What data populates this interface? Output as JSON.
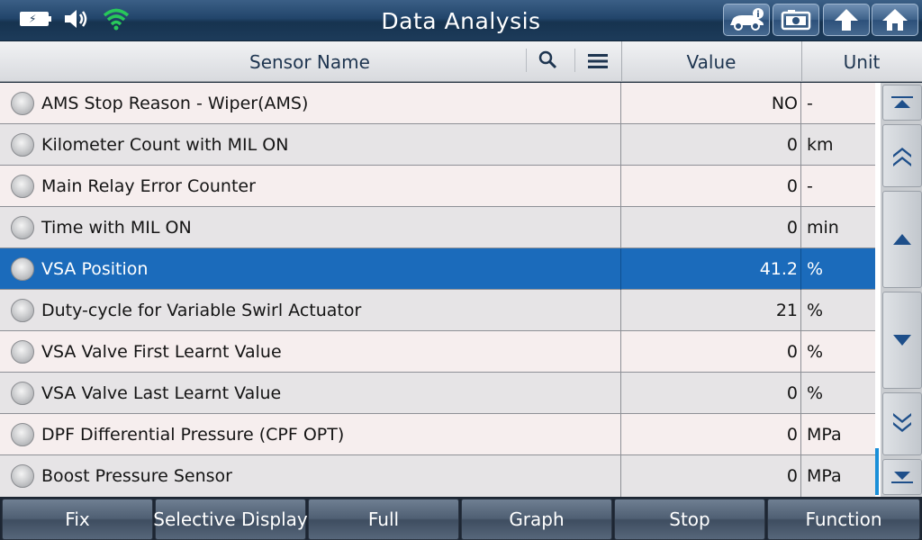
{
  "title": "Data Analysis",
  "icons": {
    "battery": "battery-charging-icon",
    "volume": "speaker-icon",
    "wifi": "wifi-icon",
    "vehicle_info": "vehicle-info-icon",
    "screenshot": "camera-icon",
    "upload": "upload-arrow-icon",
    "home": "home-icon"
  },
  "colors": {
    "selected_row": "#1b6bbb",
    "wifi": "#28c85a",
    "titlebar": "#1d3b5a"
  },
  "header": {
    "sensor_name": "Sensor Name",
    "value": "Value",
    "unit": "Unit"
  },
  "rows": [
    {
      "name": "AMS Stop Reason - Wiper(AMS)",
      "value": "NO",
      "unit": "-"
    },
    {
      "name": "Kilometer Count with MIL ON",
      "value": "0",
      "unit": "km"
    },
    {
      "name": "Main Relay Error Counter",
      "value": "0",
      "unit": "-"
    },
    {
      "name": "Time with MIL ON",
      "value": "0",
      "unit": "min"
    },
    {
      "name": "VSA Position",
      "value": "41.2",
      "unit": "%",
      "selected": true
    },
    {
      "name": "Duty-cycle for Variable Swirl Actuator",
      "value": "21",
      "unit": "%"
    },
    {
      "name": "VSA Valve First Learnt Value",
      "value": "0",
      "unit": "%"
    },
    {
      "name": "VSA Valve Last Learnt Value",
      "value": "0",
      "unit": "%"
    },
    {
      "name": "DPF Differential Pressure (CPF OPT)",
      "value": "0",
      "unit": "MPa"
    },
    {
      "name": "Boost Pressure Sensor",
      "value": "0",
      "unit": "MPa"
    }
  ],
  "bottom_buttons": [
    "Fix",
    "Selective Display",
    "Full",
    "Graph",
    "Stop",
    "Function"
  ]
}
